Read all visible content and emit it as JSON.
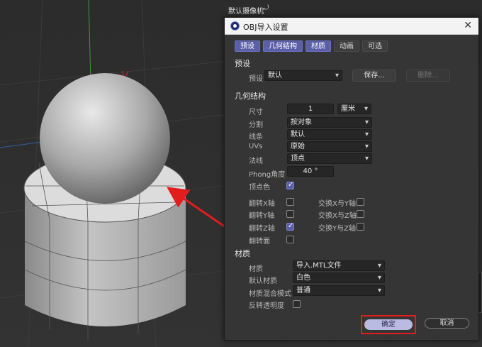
{
  "viewport": {
    "camera_label": "默认摄像机"
  },
  "dialog": {
    "title": "OBJ导入设置",
    "tabs": [
      {
        "label": "预设",
        "active": true
      },
      {
        "label": "几何结构",
        "active": true
      },
      {
        "label": "材质",
        "active": true
      },
      {
        "label": "动画",
        "active": false
      },
      {
        "label": "可选",
        "active": false
      }
    ],
    "preset": {
      "heading": "预设",
      "label": "预设",
      "value": "默认",
      "save_button": "保存...",
      "delete_button": "删除..."
    },
    "geometry": {
      "heading": "几何结构",
      "size_label": "尺寸",
      "size_value": "1",
      "size_unit": "厘米",
      "split_label": "分割",
      "split_value": "按对象",
      "lines_label": "线条",
      "lines_value": "默认",
      "uvs_label": "UVs",
      "uvs_value": "原始",
      "normals_label": "法线",
      "normals_value": "顶点",
      "phong_label": "Phong角度",
      "phong_value": "40 °",
      "vertex_color_label": "顶点色",
      "vertex_color_checked": true,
      "flip_x_label": "翻转X轴",
      "flip_x_checked": false,
      "flip_y_label": "翻转Y轴",
      "flip_y_checked": false,
      "flip_z_label": "翻转Z轴",
      "flip_z_checked": true,
      "flip_faces_label": "翻转面",
      "flip_faces_checked": false,
      "swap_xy_label": "交换X与Y轴",
      "swap_xy_checked": false,
      "swap_xz_label": "交换X与Z轴",
      "swap_xz_checked": false,
      "swap_yz_label": "交换Y与Z轴",
      "swap_yz_checked": false
    },
    "material": {
      "heading": "材质",
      "material_label": "材质",
      "material_value": "导入.MTL文件",
      "default_label": "默认材质",
      "default_value": "白色",
      "blend_label": "材质混合模式",
      "blend_value": "普通",
      "invert_label": "反转透明度",
      "invert_checked": false
    },
    "ok_button": "确定",
    "cancel_button": "取消"
  },
  "colors": {
    "accent": "#5a5fa8",
    "highlight_box": "#e21d1d",
    "arrow": "#e21d1d"
  }
}
